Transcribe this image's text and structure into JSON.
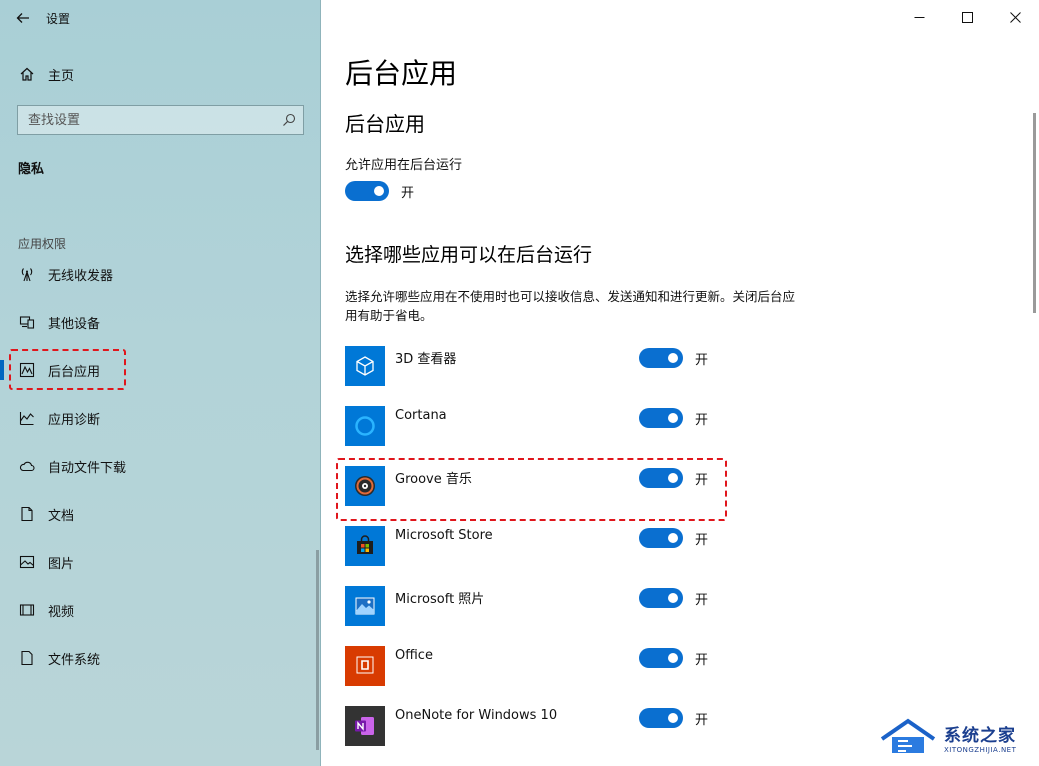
{
  "window": {
    "title": "设置",
    "minimize_label": "—",
    "maximize_label": "☐",
    "close_label": "✕"
  },
  "sidebar": {
    "home_label": "主页",
    "search_placeholder": "查找设置",
    "section_title": "隐私",
    "permissions_header": "应用权限",
    "items": [
      {
        "label": "无线收发器",
        "icon": "radio-tower-icon"
      },
      {
        "label": "其他设备",
        "icon": "devices-icon"
      },
      {
        "label": "后台应用",
        "icon": "background-apps-icon",
        "active": true
      },
      {
        "label": "应用诊断",
        "icon": "diagnostics-icon"
      },
      {
        "label": "自动文件下载",
        "icon": "cloud-icon"
      },
      {
        "label": "文档",
        "icon": "document-icon"
      },
      {
        "label": "图片",
        "icon": "picture-icon"
      },
      {
        "label": "视频",
        "icon": "video-icon"
      },
      {
        "label": "文件系统",
        "icon": "file-system-icon"
      }
    ]
  },
  "main": {
    "page_title": "后台应用",
    "section_title": "后台应用",
    "allow_label": "允许应用在后台运行",
    "allow_state": "开",
    "choose_title": "选择哪些应用可以在后台运行",
    "description": "选择允许哪些应用在不使用时也可以接收信息、发送通知和进行更新。关闭后台应用有助于省电。",
    "apps": [
      {
        "name": "3D 查看器",
        "state": "开",
        "icon": "3d-viewer-icon"
      },
      {
        "name": "Cortana",
        "state": "开",
        "icon": "cortana-icon"
      },
      {
        "name": "Groove 音乐",
        "state": "开",
        "icon": "groove-music-icon"
      },
      {
        "name": "Microsoft Store",
        "state": "开",
        "icon": "store-icon"
      },
      {
        "name": "Microsoft 照片",
        "state": "开",
        "icon": "photos-icon"
      },
      {
        "name": "Office",
        "state": "开",
        "icon": "office-icon"
      },
      {
        "name": "OneNote for Windows 10",
        "state": "开",
        "icon": "onenote-icon"
      }
    ]
  },
  "watermark": {
    "main": "系统之家",
    "sub": "XITONGZHIJIA.NET"
  },
  "colors": {
    "accent": "#0a6fd0",
    "sidebar_bg": "#b2d3d8",
    "highlight_dash": "#e0161c",
    "app_tile": "#0078d7"
  }
}
